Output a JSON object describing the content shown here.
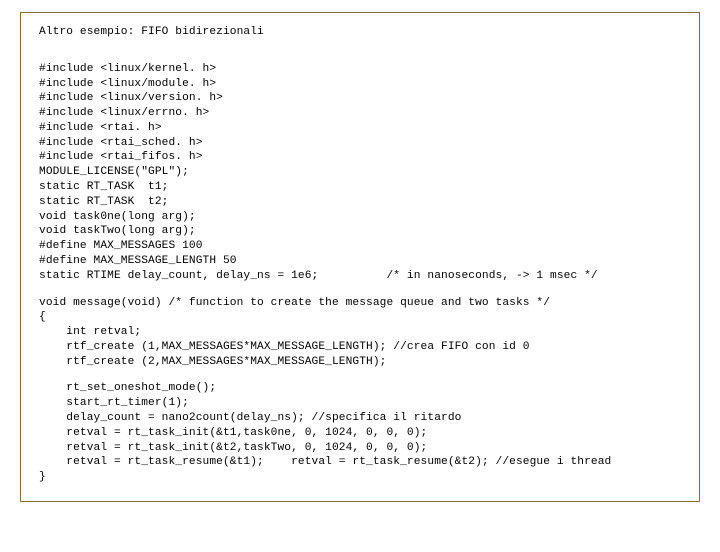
{
  "title": "Altro esempio: FIFO bidirezionali",
  "code1": "#include <linux/kernel. h>\n#include <linux/module. h>\n#include <linux/version. h>\n#include <linux/errno. h>\n#include <rtai. h>\n#include <rtai_sched. h>\n#include <rtai_fifos. h>\nMODULE_LICENSE(\"GPL\");\nstatic RT_TASK  t1;\nstatic RT_TASK  t2;\nvoid task0ne(long arg);\nvoid taskTwo(long arg);\n#define MAX_MESSAGES 100\n#define MAX_MESSAGE_LENGTH 50\nstatic RTIME delay_count, delay_ns = 1e6;          /* in nanoseconds, -> 1 msec */",
  "code2": "void message(void) /* function to create the message queue and two tasks */\n{\n    int retval;\n    rtf_create (1,MAX_MESSAGES*MAX_MESSAGE_LENGTH); //crea FIFO con id 0\n    rtf_create (2,MAX_MESSAGES*MAX_MESSAGE_LENGTH);",
  "code3": "    rt_set_oneshot_mode();\n    start_rt_timer(1);\n    delay_count = nano2count(delay_ns); //specifica il ritardo\n    retval = rt_task_init(&t1,task0ne, 0, 1024, 0, 0, 0);\n    retval = rt_task_init(&t2,taskTwo, 0, 1024, 0, 0, 0);\n    retval = rt_task_resume(&t1);    retval = rt_task_resume(&t2); //esegue i thread\n}"
}
